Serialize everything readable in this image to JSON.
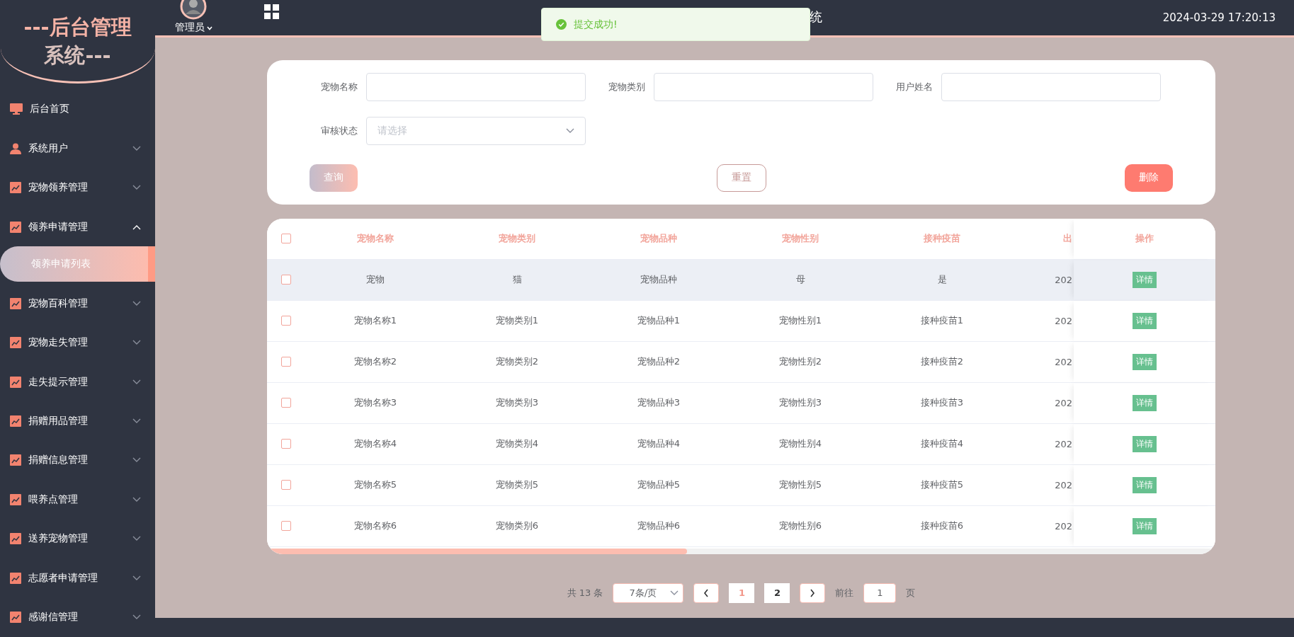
{
  "logo": {
    "line_1": "---后台管理",
    "line_2": "系统---"
  },
  "header": {
    "user": "管理员",
    "title_fragment": "统",
    "datetime": "2024-03-29 17:20:13"
  },
  "toast": {
    "kind": "success",
    "message": "提交成功!"
  },
  "sidebar": {
    "items": [
      {
        "label": "后台首页",
        "kind": "home"
      },
      {
        "label": "系统用户",
        "kind": "user",
        "expanded": false
      },
      {
        "label": "宠物领养管理",
        "kind": "module",
        "expanded": false
      },
      {
        "label": "领养申请管理",
        "kind": "module",
        "expanded": true,
        "children": [
          {
            "label": "领养申请列表",
            "selected": true
          }
        ]
      },
      {
        "label": "宠物百科管理",
        "kind": "module",
        "expanded": false
      },
      {
        "label": "宠物走失管理",
        "kind": "module",
        "expanded": false
      },
      {
        "label": "走失提示管理",
        "kind": "module",
        "expanded": false
      },
      {
        "label": "捐赠用品管理",
        "kind": "module",
        "expanded": false
      },
      {
        "label": "捐赠信息管理",
        "kind": "module",
        "expanded": false
      },
      {
        "label": "喂养点管理",
        "kind": "module",
        "expanded": false
      },
      {
        "label": "送养宠物管理",
        "kind": "module",
        "expanded": false
      },
      {
        "label": "志愿者申请管理",
        "kind": "module",
        "expanded": false
      },
      {
        "label": "感谢信管理",
        "kind": "module",
        "expanded": false
      }
    ]
  },
  "filters": [
    {
      "kind": "input",
      "label": "宠物名称"
    },
    {
      "kind": "input",
      "label": "宠物类别"
    },
    {
      "kind": "input",
      "label": "用户姓名"
    },
    {
      "kind": "select",
      "label": "审核状态",
      "placeholder": "请选择"
    }
  ],
  "buttons": [
    {
      "kind": "primary",
      "label": "查询"
    },
    {
      "kind": "outline",
      "label": "重置"
    },
    {
      "kind": "danger",
      "label": "删除"
    }
  ],
  "table": {
    "select_all_checked": false,
    "columns": [
      "宠物名称",
      "宠物类别",
      "宠物品种",
      "宠物性别",
      "接种疫苗",
      "出"
    ],
    "action_column": "操作",
    "rows": [
      {
        "checked": false,
        "highlighted": true,
        "cells": [
          "宠物",
          "猫",
          "宠物品种",
          "母",
          "是",
          "202"
        ],
        "action": "详情"
      },
      {
        "checked": false,
        "highlighted": false,
        "cells": [
          "宠物名称1",
          "宠物类别1",
          "宠物品种1",
          "宠物性别1",
          "接种疫苗1",
          "202"
        ],
        "action": "详情"
      },
      {
        "checked": false,
        "highlighted": false,
        "cells": [
          "宠物名称2",
          "宠物类别2",
          "宠物品种2",
          "宠物性别2",
          "接种疫苗2",
          "202"
        ],
        "action": "详情"
      },
      {
        "checked": false,
        "highlighted": false,
        "cells": [
          "宠物名称3",
          "宠物类别3",
          "宠物品种3",
          "宠物性别3",
          "接种疫苗3",
          "202"
        ],
        "action": "详情"
      },
      {
        "checked": false,
        "highlighted": false,
        "cells": [
          "宠物名称4",
          "宠物类别4",
          "宠物品种4",
          "宠物性别4",
          "接种疫苗4",
          "202"
        ],
        "action": "详情"
      },
      {
        "checked": false,
        "highlighted": false,
        "cells": [
          "宠物名称5",
          "宠物类别5",
          "宠物品种5",
          "宠物性别5",
          "接种疫苗5",
          "202"
        ],
        "action": "详情"
      },
      {
        "checked": false,
        "highlighted": false,
        "cells": [
          "宠物名称6",
          "宠物类别6",
          "宠物品种6",
          "宠物性别6",
          "接种疫苗6",
          "202"
        ],
        "action": "详情"
      }
    ]
  },
  "pagination": {
    "total": "共 13 条",
    "page_size": "7条/页",
    "pages": [
      {
        "label": "1",
        "selected": true
      },
      {
        "label": "2",
        "selected": false
      }
    ],
    "goto_label": "前往",
    "goto_value": "1",
    "goto_suffix": "页"
  }
}
